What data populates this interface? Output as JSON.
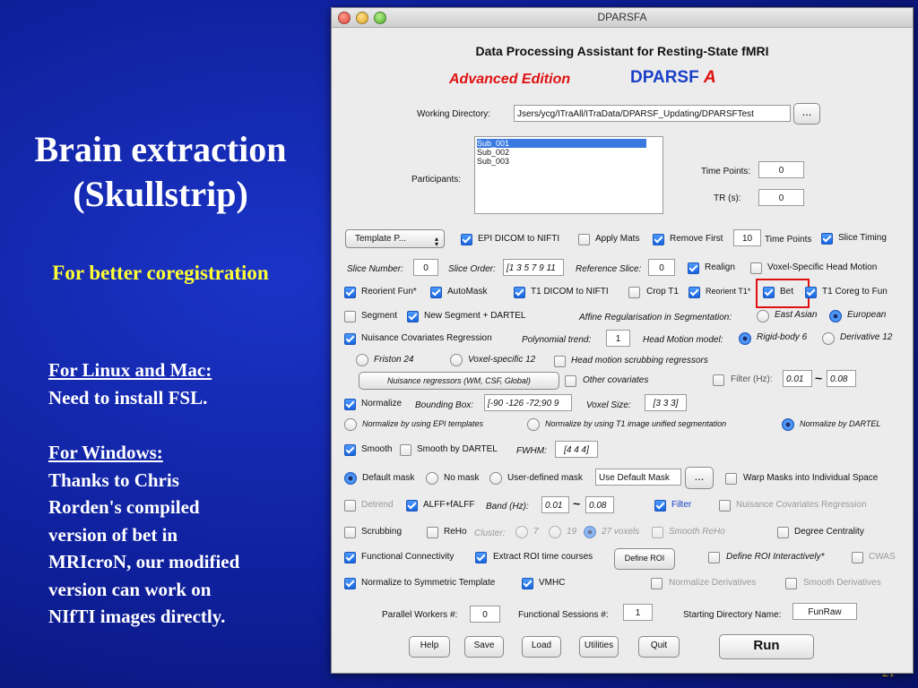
{
  "slide": {
    "title_line1": "Brain extraction",
    "title_line2": "(Skullstrip)",
    "subtitle": "For better coregistration",
    "linux_heading": "For Linux and Mac:",
    "linux_text": "Need to install FSL.",
    "windows_heading": "For Windows:",
    "windows_lines": [
      "Thanks to Chris",
      "Rorden's compiled",
      "version of bet in",
      "MRIcroN, our modified",
      "version can work on",
      "NIfTI images directly."
    ],
    "page_number": "21"
  },
  "window": {
    "title": "DPARSFA",
    "heading": "Data Processing Assistant for Resting-State fMRI",
    "edition": "Advanced Edition",
    "logo_text": "DPARSF",
    "logo_suffix": "A",
    "working_dir_label": "Working Directory:",
    "working_dir_value": "Jsers/ycg/ITraAll/ITraData/DPARSF_Updating/DPARSFTest",
    "browse_label": "...",
    "participants_label": "Participants:",
    "participants": [
      "Sub_001",
      "Sub_002",
      "Sub_003"
    ],
    "time_points_label": "Time Points:",
    "time_points_value": "0",
    "tr_label": "TR (s):",
    "tr_value": "0",
    "template_select": "Template P...",
    "epi_dicom": "EPI DICOM to NIFTI",
    "apply_mats": "Apply Mats",
    "remove_first": "Remove First",
    "remove_first_value": "10",
    "time_points_unit": "Time Points",
    "slice_timing": "Slice Timing",
    "slice_number_label": "Slice Number:",
    "slice_number_value": "0",
    "slice_order_label": "Slice Order:",
    "slice_order_value": "[1 3 5 7 9 11",
    "reference_slice_label": "Reference Slice:",
    "reference_slice_value": "0",
    "realign": "Realign",
    "voxel_specific_head_motion": "Voxel-Specific Head Motion",
    "reorient_fun": "Reorient Fun*",
    "automask": "AutoMask",
    "t1_dicom": "T1 DICOM to NIFTI",
    "crop_t1": "Crop T1",
    "reorient_t1": "Reorient T1*",
    "bet": "Bet",
    "t1_coreg": "T1 Coreg to Fun",
    "segment": "Segment",
    "new_segment": "New Segment + DARTEL",
    "affine_label": "Affine Regularisation in Segmentation:",
    "east_asian": "East Asian",
    "european": "European",
    "nuisance_cov": "Nuisance Covariates Regression",
    "poly_trend_label": "Polynomial trend:",
    "poly_trend_value": "1",
    "head_motion_model_label": "Head Motion model:",
    "rigid_body": "Rigid-body 6",
    "derivative12": "Derivative 12",
    "friston24": "Friston 24",
    "voxel_specific12": "Voxel-specific 12",
    "head_motion_scrub": "Head motion scrubbing regressors",
    "nuisance_regressors_button": "Nuisance regressors (WM, CSF, Global)",
    "other_covariates": "Other covariates",
    "filter_label": "Filter (Hz):",
    "filter_low": "0.01",
    "filter_high": "0.08",
    "tilde": "~",
    "normalize": "Normalize",
    "bounding_box_label": "Bounding Box:",
    "bounding_box_value": "[-90 -126 -72;90 9",
    "voxel_size_label": "Voxel Size:",
    "voxel_size_value": "[3 3 3]",
    "norm_epi": "Normalize by using EPI templates",
    "norm_t1": "Normalize by using T1 image unified segmentation",
    "norm_dartel": "Normalize by DARTEL",
    "smooth": "Smooth",
    "smooth_dartel": "Smooth by DARTEL",
    "fwhm_label": "FWHM:",
    "fwhm_value": "[4 4 4]",
    "default_mask": "Default mask",
    "no_mask": "No mask",
    "user_mask": "User-defined mask",
    "use_default_mask": "Use Default Mask",
    "mask_browse": "...",
    "warp_masks": "Warp Masks into Individual Space",
    "detrend": "Detrend",
    "alff": "ALFF+fALFF",
    "band_label": "Band (Hz):",
    "band_low": "0.01",
    "band_high": "0.08",
    "filter": "Filter",
    "nuisance_cov2": "Nuisance Covariates Regression",
    "scrubbing": "Scrubbing",
    "reho": "ReHo",
    "cluster_label": "Cluster:",
    "cluster7": "7",
    "cluster19": "19",
    "cluster27": "27 voxels",
    "smooth_reho": "Smooth ReHo",
    "degree_centrality": "Degree Centrality",
    "functional_connectivity": "Functional Connectivity",
    "extract_roi": "Extract ROI time courses",
    "define_roi": "Define ROI",
    "define_roi_interactive": "Define ROI Interactively*",
    "cwas": "CWAS",
    "normalize_symmetric": "Normalize to Symmetric Template",
    "vmhc": "VMHC",
    "normalize_derivatives": "Normalize Derivatives",
    "smooth_derivatives": "Smooth Derivatives",
    "parallel_workers_label": "Parallel Workers #:",
    "parallel_workers_value": "0",
    "functional_sessions_label": "Functional Sessions #:",
    "functional_sessions_value": "1",
    "starting_dir_label": "Starting Directory Name:",
    "starting_dir_value": "FunRaw",
    "help": "Help",
    "save": "Save",
    "load": "Load",
    "utilities": "Utilities",
    "quit": "Quit",
    "run": "Run"
  },
  "colors": {
    "background": "#0e1f9a",
    "title": "#ffffff",
    "subtitle": "#ffff33",
    "highlight_box": "#e01010",
    "edition": "#e01010",
    "logo": "#1a3fc8"
  },
  "icons": [
    "speaker-icon"
  ]
}
